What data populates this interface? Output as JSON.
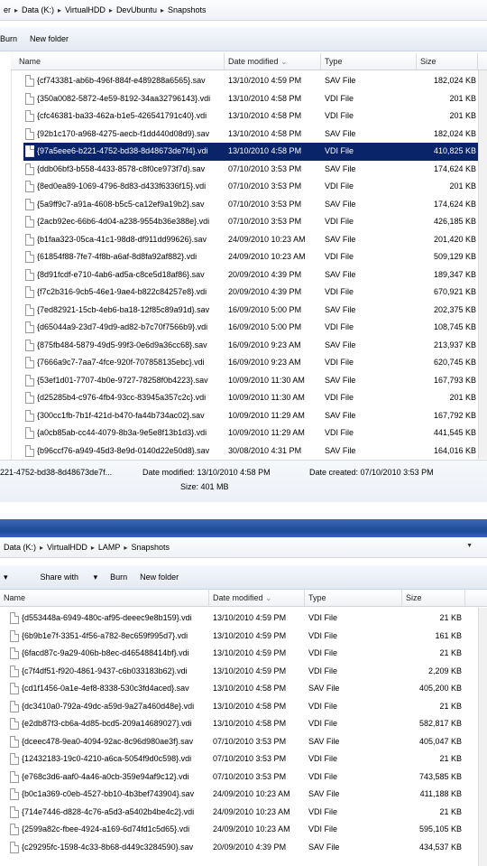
{
  "w1": {
    "breadcrumb": [
      "er",
      "Data (K:)",
      "VirtualHDD",
      "DevUbuntu",
      "Snapshots"
    ],
    "toolbar": [
      "Burn",
      "New folder"
    ],
    "columns": [
      "Name",
      "Date modified",
      "Type",
      "Size"
    ],
    "files": [
      {
        "name": "{cf743381-ab6b-496f-884f-e489288a6565}.sav",
        "date": "13/10/2010 4:59 PM",
        "type": "SAV File",
        "size": "182,024 KB"
      },
      {
        "name": "{350a0082-5872-4e59-8192-34aa32796143}.vdi",
        "date": "13/10/2010 4:58 PM",
        "type": "VDI File",
        "size": "201 KB"
      },
      {
        "name": "{cfc46381-ba33-462a-b1e5-426541791c40}.vdi",
        "date": "13/10/2010 4:58 PM",
        "type": "VDI File",
        "size": "201 KB"
      },
      {
        "name": "{92b1c170-a968-4275-aecb-f1dd440d08d9}.sav",
        "date": "13/10/2010 4:58 PM",
        "type": "SAV File",
        "size": "182,024 KB"
      },
      {
        "name": "{97a5eee6-b221-4752-bd38-8d48673de7f4}.vdi",
        "date": "13/10/2010 4:58 PM",
        "type": "VDI File",
        "size": "410,825 KB",
        "selected": true
      },
      {
        "name": "{ddb06bf3-b558-4433-8578-c8f0ce973f7d}.sav",
        "date": "07/10/2010 3:53 PM",
        "type": "SAV File",
        "size": "174,624 KB"
      },
      {
        "name": "{8ed0ea89-1069-4796-8d83-d433f6336f15}.vdi",
        "date": "07/10/2010 3:53 PM",
        "type": "VDI File",
        "size": "201 KB"
      },
      {
        "name": "{5a9ff9c7-a91a-4608-b5c5-ca12ef9a19b2}.sav",
        "date": "07/10/2010 3:53 PM",
        "type": "SAV File",
        "size": "174,624 KB"
      },
      {
        "name": "{2acb92ec-66b6-4d04-a238-9554b36e388e}.vdi",
        "date": "07/10/2010 3:53 PM",
        "type": "VDI File",
        "size": "426,185 KB"
      },
      {
        "name": "{b1faa323-05ca-41c1-98d8-df911dd99626}.sav",
        "date": "24/09/2010 10:23 AM",
        "type": "SAV File",
        "size": "201,420 KB"
      },
      {
        "name": "{61854f88-7fe7-4f8b-a6af-8d8fa92af882}.vdi",
        "date": "24/09/2010 10:23 AM",
        "type": "VDI File",
        "size": "509,129 KB"
      },
      {
        "name": "{8d91fcdf-e710-4ab6-ad5a-c8ce5d18af86}.sav",
        "date": "20/09/2010 4:39 PM",
        "type": "SAV File",
        "size": "189,347 KB"
      },
      {
        "name": "{f7c2b316-9cb5-46e1-9ae4-b822c84257e8}.vdi",
        "date": "20/09/2010 4:39 PM",
        "type": "VDI File",
        "size": "670,921 KB"
      },
      {
        "name": "{7ed82921-15cb-4eb6-ba18-12f85c89a91d}.sav",
        "date": "16/09/2010 5:00 PM",
        "type": "SAV File",
        "size": "202,375 KB"
      },
      {
        "name": "{d65044a9-23d7-49d9-ad82-b7c70f7566b9}.vdi",
        "date": "16/09/2010 5:00 PM",
        "type": "VDI File",
        "size": "108,745 KB"
      },
      {
        "name": "{875fb484-5879-49d5-99f3-0e6d9a36cc68}.sav",
        "date": "16/09/2010 9:23 AM",
        "type": "SAV File",
        "size": "213,937 KB"
      },
      {
        "name": "{7666a9c7-7aa7-4fce-920f-707858135ebc}.vdi",
        "date": "16/09/2010 9:23 AM",
        "type": "VDI File",
        "size": "620,745 KB"
      },
      {
        "name": "{53ef1d01-7707-4b0e-9727-78258f0b4223}.sav",
        "date": "10/09/2010 11:30 AM",
        "type": "SAV File",
        "size": "167,793 KB"
      },
      {
        "name": "{d25285b4-c976-4fb4-93cc-83945a357c2c}.vdi",
        "date": "10/09/2010 11:30 AM",
        "type": "VDI File",
        "size": "201 KB"
      },
      {
        "name": "{300cc1fb-7b1f-421d-b470-fa44b734ac02}.sav",
        "date": "10/09/2010 11:29 AM",
        "type": "SAV File",
        "size": "167,792 KB"
      },
      {
        "name": "{a0cb85ab-cc44-4079-8b3a-9e5e8f13b1d3}.vdi",
        "date": "10/09/2010 11:29 AM",
        "type": "VDI File",
        "size": "441,545 KB"
      },
      {
        "name": "{b96ccf76-a949-45d3-8e9d-0140d22e50d8}.sav",
        "date": "30/08/2010 4:31 PM",
        "type": "SAV File",
        "size": "164,016 KB"
      }
    ],
    "details": {
      "name": "221-4752-bd38-8d48673de7f...",
      "modified": "Date modified: 13/10/2010 4:58 PM",
      "created": "Date created: 07/10/2010 3:53 PM",
      "size": "Size: 401 MB"
    }
  },
  "w2": {
    "breadcrumb": [
      "Data (K:)",
      "VirtualHDD",
      "LAMP",
      "Snapshots"
    ],
    "toolbar": [
      "Share with",
      "Burn",
      "New folder"
    ],
    "columns": [
      "Name",
      "Date modified",
      "Type",
      "Size"
    ],
    "files": [
      {
        "name": "{d553448a-6949-480c-af95-deeec9e8b159}.vdi",
        "date": "13/10/2010 4:59 PM",
        "type": "VDI File",
        "size": "21 KB"
      },
      {
        "name": "{6b9b1e7f-3351-4f56-a782-8ec659f995d7}.vdi",
        "date": "13/10/2010 4:59 PM",
        "type": "VDI File",
        "size": "161 KB"
      },
      {
        "name": "{6facd87c-9a29-406b-b8ec-d465488414bf}.vdi",
        "date": "13/10/2010 4:59 PM",
        "type": "VDI File",
        "size": "21 KB"
      },
      {
        "name": "{c7f4df51-f920-4861-9437-c6b033183b62}.vdi",
        "date": "13/10/2010 4:59 PM",
        "type": "VDI File",
        "size": "2,209 KB"
      },
      {
        "name": "{cd1f1456-0a1e-4ef8-8338-530c3fd4aced}.sav",
        "date": "13/10/2010 4:58 PM",
        "type": "SAV File",
        "size": "405,200 KB"
      },
      {
        "name": "{dc3410a0-792a-49dc-a59d-9a27a460d48e}.vdi",
        "date": "13/10/2010 4:58 PM",
        "type": "VDI File",
        "size": "21 KB"
      },
      {
        "name": "{e2db87f3-cb6a-4d85-bcd5-209a14689027}.vdi",
        "date": "13/10/2010 4:58 PM",
        "type": "VDI File",
        "size": "582,817 KB"
      },
      {
        "name": "{dceec478-9ea0-4094-92ac-8c96d980ae3f}.sav",
        "date": "07/10/2010 3:53 PM",
        "type": "SAV File",
        "size": "405,047 KB"
      },
      {
        "name": "{12432183-19c0-4210-a6ca-5054f9d0c598}.vdi",
        "date": "07/10/2010 3:53 PM",
        "type": "VDI File",
        "size": "21 KB"
      },
      {
        "name": "{e768c3d6-aaf0-4a46-a0cb-359e94af9c12}.vdi",
        "date": "07/10/2010 3:53 PM",
        "type": "VDI File",
        "size": "743,585 KB"
      },
      {
        "name": "{b0c1a369-c0eb-4527-bb10-4b3bef743904}.sav",
        "date": "24/09/2010 10:23 AM",
        "type": "SAV File",
        "size": "411,188 KB"
      },
      {
        "name": "{714e7446-d828-4c76-a5d3-a5402b4be4c2}.vdi",
        "date": "24/09/2010 10:23 AM",
        "type": "VDI File",
        "size": "21 KB"
      },
      {
        "name": "{2599a82c-fbee-4924-a169-6d74fd1c5d65}.vdi",
        "date": "24/09/2010 10:23 AM",
        "type": "VDI File",
        "size": "595,105 KB"
      },
      {
        "name": "{c29295fc-1598-4c33-8b68-d449c3284590}.sav",
        "date": "20/09/2010 4:39 PM",
        "type": "SAV File",
        "size": "434,537 KB"
      }
    ]
  }
}
